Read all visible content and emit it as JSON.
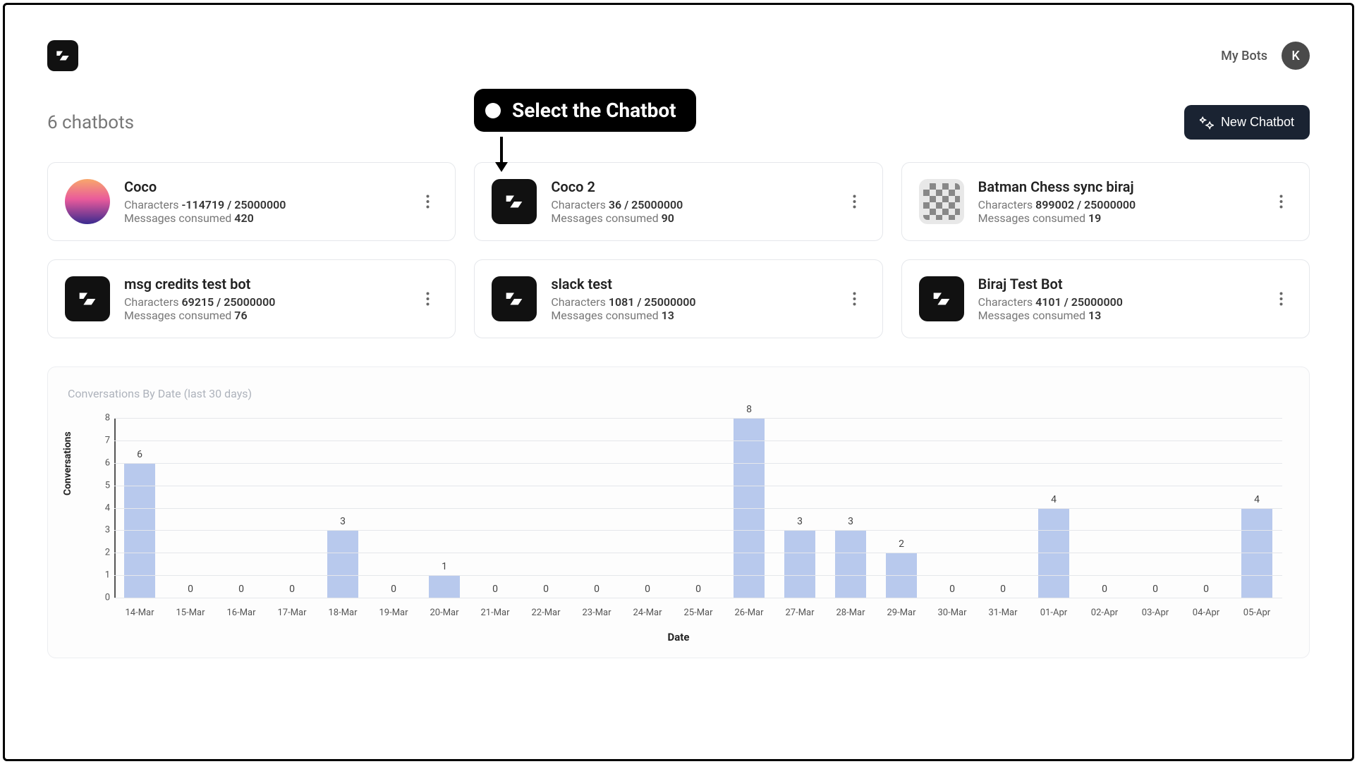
{
  "header": {
    "my_bots": "My Bots",
    "avatar_letter": "K"
  },
  "page": {
    "title": "6 chatbots",
    "new_btn": "New Chatbot"
  },
  "callout": {
    "text": "Select the Chatbot"
  },
  "bots": [
    {
      "name": "Coco",
      "chars_prefix": "Characters ",
      "chars": "-114719 / 25000000",
      "msgs_prefix": "Messages consumed ",
      "msgs": "420",
      "icon": "gradient"
    },
    {
      "name": "Coco 2",
      "chars_prefix": "Characters ",
      "chars": "36 / 25000000",
      "msgs_prefix": "Messages consumed ",
      "msgs": "90",
      "icon": "dark"
    },
    {
      "name": "Batman Chess sync biraj",
      "chars_prefix": "Characters ",
      "chars": "899002 / 25000000",
      "msgs_prefix": "Messages consumed ",
      "msgs": "19",
      "icon": "chess"
    },
    {
      "name": "msg credits test bot",
      "chars_prefix": "Characters ",
      "chars": "69215 / 25000000",
      "msgs_prefix": "Messages consumed ",
      "msgs": "76",
      "icon": "dark"
    },
    {
      "name": "slack test",
      "chars_prefix": "Characters ",
      "chars": "1081 / 25000000",
      "msgs_prefix": "Messages consumed ",
      "msgs": "13",
      "icon": "dark"
    },
    {
      "name": "Biraj Test Bot",
      "chars_prefix": "Characters ",
      "chars": "4101 / 25000000",
      "msgs_prefix": "Messages consumed ",
      "msgs": "13",
      "icon": "dark"
    }
  ],
  "chart_title": {
    "main": "Conversations By Date ",
    "sub": "(last 30 days)"
  },
  "chart_data": {
    "type": "bar",
    "title": "Conversations By Date (last 30 days)",
    "xlabel": "Date",
    "ylabel": "Conversations",
    "ylim": [
      0,
      8
    ],
    "yticks": [
      0,
      1,
      2,
      3,
      4,
      5,
      6,
      7,
      8
    ],
    "categories": [
      "14-Mar",
      "15-Mar",
      "16-Mar",
      "17-Mar",
      "18-Mar",
      "19-Mar",
      "20-Mar",
      "21-Mar",
      "22-Mar",
      "23-Mar",
      "24-Mar",
      "25-Mar",
      "26-Mar",
      "27-Mar",
      "28-Mar",
      "29-Mar",
      "30-Mar",
      "31-Mar",
      "01-Apr",
      "02-Apr",
      "03-Apr",
      "04-Apr",
      "05-Apr"
    ],
    "values": [
      6,
      0,
      0,
      0,
      3,
      0,
      1,
      0,
      0,
      0,
      0,
      0,
      8,
      3,
      3,
      2,
      0,
      0,
      4,
      0,
      0,
      0,
      4
    ]
  }
}
